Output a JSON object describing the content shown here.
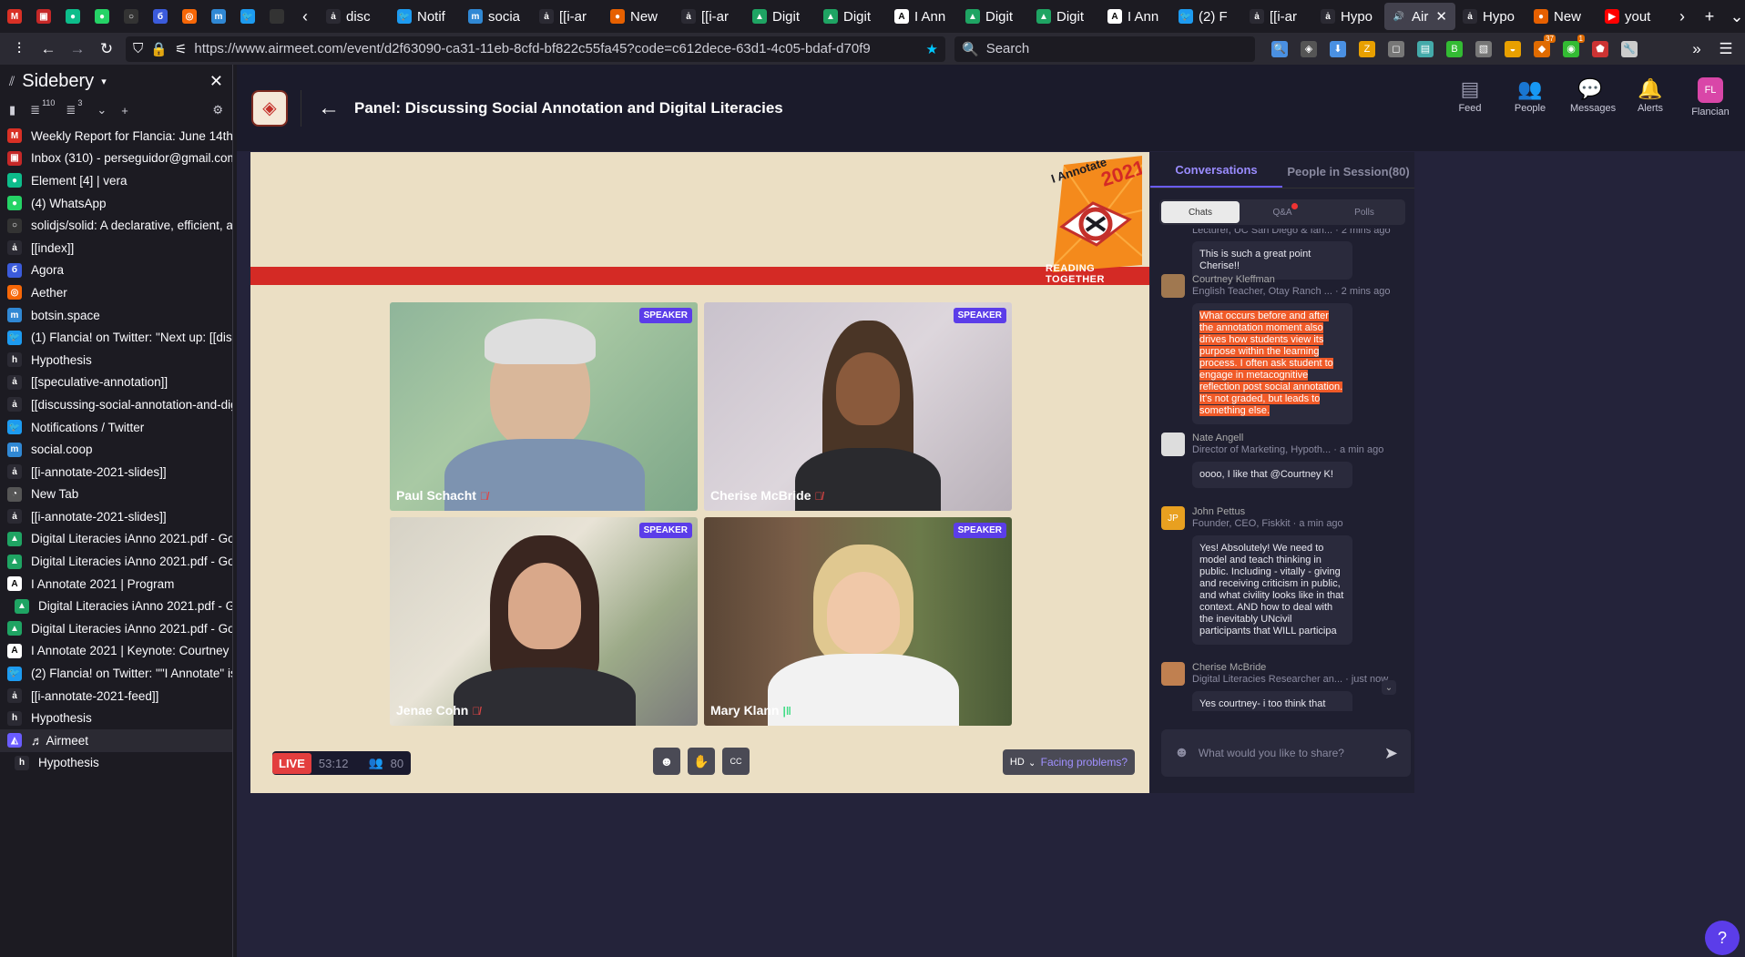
{
  "browser": {
    "pinned_tabs": [
      {
        "icon": "gmail-icon",
        "color": "#d93025",
        "glyph": "M"
      },
      {
        "icon": "inbox-icon",
        "color": "#c62828",
        "glyph": "▣"
      },
      {
        "icon": "element-icon",
        "color": "#0dbd8b",
        "glyph": "●"
      },
      {
        "icon": "whatsapp-icon",
        "color": "#25d366",
        "glyph": "●"
      },
      {
        "icon": "github-icon",
        "color": "#333",
        "glyph": "○"
      },
      {
        "icon": "agora-icon",
        "color": "#3b5bdb",
        "glyph": "б"
      },
      {
        "icon": "aether-icon",
        "color": "#f76707",
        "glyph": "◎"
      },
      {
        "icon": "mastodon-icon",
        "color": "#3088d4",
        "glyph": "m"
      },
      {
        "icon": "twitter-icon",
        "color": "#1d9bf0",
        "glyph": "🐦"
      },
      {
        "icon": "blank-icon",
        "color": "#333",
        "glyph": ""
      }
    ],
    "tabs": [
      {
        "label": "disc",
        "icon": "hypothesis-icon",
        "color": "#2b2a33",
        "glyph": "ȧ"
      },
      {
        "label": "Notif",
        "icon": "twitter-icon",
        "color": "#1d9bf0",
        "glyph": "🐦"
      },
      {
        "label": "socia",
        "icon": "mastodon-icon",
        "color": "#3088d4",
        "glyph": "m"
      },
      {
        "label": "[[i-ar",
        "icon": "hypothesis-icon",
        "color": "#2b2a33",
        "glyph": "ȧ"
      },
      {
        "label": "New",
        "icon": "firefox-icon",
        "color": "#e66000",
        "glyph": "●"
      },
      {
        "label": "[[i-ar",
        "icon": "hypothesis-icon",
        "color": "#2b2a33",
        "glyph": "ȧ"
      },
      {
        "label": "Digit",
        "icon": "drive-icon",
        "color": "#1fa463",
        "glyph": "▲"
      },
      {
        "label": "Digit",
        "icon": "drive-icon",
        "color": "#1fa463",
        "glyph": "▲"
      },
      {
        "label": "I Ann",
        "icon": "iannotate-icon",
        "color": "#ffffff",
        "glyph": "A"
      },
      {
        "label": "Digit",
        "icon": "drive-icon",
        "color": "#1fa463",
        "glyph": "▲"
      },
      {
        "label": "Digit",
        "icon": "drive-icon",
        "color": "#1fa463",
        "glyph": "▲"
      },
      {
        "label": "I Ann",
        "icon": "iannotate-icon",
        "color": "#ffffff",
        "glyph": "A"
      },
      {
        "label": "(2) F",
        "icon": "twitter-icon",
        "color": "#1d9bf0",
        "glyph": "🐦"
      },
      {
        "label": "[[i-ar",
        "icon": "hypothesis-icon",
        "color": "#2b2a33",
        "glyph": "ȧ"
      },
      {
        "label": "Hypo",
        "icon": "hypothesis-icon",
        "color": "#2b2a33",
        "glyph": "ȧ"
      },
      {
        "label": "Air",
        "icon": "speaker-icon",
        "color": "#42414d",
        "glyph": "🔊",
        "active": true
      },
      {
        "label": "Hypo",
        "icon": "hypothesis-icon",
        "color": "#2b2a33",
        "glyph": "ȧ"
      },
      {
        "label": "New",
        "icon": "firefox-icon",
        "color": "#e66000",
        "glyph": "●"
      },
      {
        "label": "yout",
        "icon": "youtube-icon",
        "color": "#ff0000",
        "glyph": "▶"
      }
    ],
    "url": "https://www.airmeet.com/event/d2f63090-ca31-11eb-8cfd-bf822c55fa45?code=c612dece-63d1-4c05-bdaf-d70f9",
    "search_placeholder": "Search",
    "extensions": [
      {
        "icon": "search-icon",
        "color": "#4a90e2",
        "glyph": "🔍"
      },
      {
        "icon": "pocket-icon",
        "color": "#555",
        "glyph": "◈"
      },
      {
        "icon": "download-icon",
        "color": "#4a90e2",
        "glyph": "⬇"
      },
      {
        "icon": "zotero-icon",
        "color": "#e8a000",
        "glyph": "Z"
      },
      {
        "icon": "box-icon",
        "color": "#777",
        "glyph": "◻"
      },
      {
        "icon": "rss-icon",
        "color": "#4aa",
        "glyph": "▤"
      },
      {
        "icon": "badge-icon",
        "color": "#3b3",
        "glyph": "B"
      },
      {
        "icon": "page-icon",
        "color": "#777",
        "glyph": "▧"
      },
      {
        "icon": "burger-icon",
        "color": "#e8a000",
        "glyph": "◒"
      },
      {
        "icon": "ext-badge-icon",
        "color": "#e06b00",
        "glyph": "◆",
        "badge": "37"
      },
      {
        "icon": "eye-icon",
        "color": "#3b3",
        "glyph": "◉",
        "badge": "1"
      },
      {
        "icon": "shield-icon",
        "color": "#c33",
        "glyph": "⬟"
      },
      {
        "icon": "wrench-icon",
        "color": "#ccc",
        "glyph": "🔧"
      }
    ]
  },
  "sidebar": {
    "title": "Sidebery",
    "count_a": "110",
    "count_b": "3",
    "items": [
      {
        "label": "Weekly Report for Flancia: June 14th, 2021",
        "icon": "gmail-icon",
        "color": "#d93025",
        "glyph": "M"
      },
      {
        "label": "Inbox (310) - perseguidor@gmail.com - Gm",
        "icon": "inbox-icon",
        "color": "#c62828",
        "glyph": "▣"
      },
      {
        "label": "Element [4] | vera",
        "icon": "element-icon",
        "color": "#0dbd8b",
        "glyph": "●"
      },
      {
        "label": "(4) WhatsApp",
        "icon": "whatsapp-icon",
        "color": "#25d366",
        "glyph": "●"
      },
      {
        "label": "solidjs/solid: A declarative, efficient, and fle",
        "icon": "github-icon",
        "color": "#333",
        "glyph": "○"
      },
      {
        "label": "[[index]]",
        "icon": "hypothesis-icon",
        "color": "#2b2a33",
        "glyph": "ȧ"
      },
      {
        "label": "Agora",
        "icon": "agora-icon",
        "color": "#3b5bdb",
        "glyph": "б"
      },
      {
        "label": "Aether",
        "icon": "aether-icon",
        "color": "#f76707",
        "glyph": "◎"
      },
      {
        "label": "botsin.space",
        "icon": "mastodon-icon",
        "color": "#3088d4",
        "glyph": "m"
      },
      {
        "label": "(1) Flancia! on Twitter: \"Next up: [[discussin",
        "icon": "twitter-icon",
        "color": "#1d9bf0",
        "glyph": "🐦"
      },
      {
        "label": "Hypothesis",
        "icon": "hypothesis-icon",
        "color": "#2b2a33",
        "glyph": "h"
      },
      {
        "label": "[[speculative-annotation]]",
        "icon": "hypothesis-icon",
        "color": "#2b2a33",
        "glyph": "ȧ"
      },
      {
        "label": "[[discussing-social-annotation-and-digital-li",
        "icon": "hypothesis-icon",
        "color": "#2b2a33",
        "glyph": "ȧ"
      },
      {
        "label": "Notifications / Twitter",
        "icon": "twitter-icon",
        "color": "#1d9bf0",
        "glyph": "🐦"
      },
      {
        "label": "social.coop",
        "icon": "mastodon-icon",
        "color": "#3088d4",
        "glyph": "m"
      },
      {
        "label": "[[i-annotate-2021-slides]]",
        "icon": "hypothesis-icon",
        "color": "#2b2a33",
        "glyph": "ȧ"
      },
      {
        "label": "New Tab",
        "icon": "firefox-icon",
        "color": "#555",
        "glyph": "◔"
      },
      {
        "label": "[[i-annotate-2021-slides]]",
        "icon": "hypothesis-icon",
        "color": "#2b2a33",
        "glyph": "ȧ"
      },
      {
        "label": "Digital Literacies iAnno 2021.pdf - Google D",
        "icon": "drive-icon",
        "color": "#1fa463",
        "glyph": "▲"
      },
      {
        "label": "Digital Literacies iAnno 2021.pdf - Google D",
        "icon": "drive-icon",
        "color": "#1fa463",
        "glyph": "▲"
      },
      {
        "label": "I Annotate 2021 | Program",
        "icon": "iannotate-icon",
        "color": "#ffffff",
        "glyph": "A"
      },
      {
        "label": "Digital Literacies iAnno 2021.pdf - Google",
        "icon": "drive-icon",
        "color": "#1fa463",
        "glyph": "▲",
        "child": true
      },
      {
        "label": "Digital Literacies iAnno 2021.pdf - Google D",
        "icon": "drive-icon",
        "color": "#1fa463",
        "glyph": "▲"
      },
      {
        "label": "I Annotate 2021 | Keynote: Courtney McCle",
        "icon": "iannotate-icon",
        "color": "#ffffff",
        "glyph": "A"
      },
      {
        "label": "(2) Flancia! on Twitter: \"\"I Annotate\" is goin",
        "icon": "twitter-icon",
        "color": "#1d9bf0",
        "glyph": "🐦"
      },
      {
        "label": "[[i-annotate-2021-feed]]",
        "icon": "hypothesis-icon",
        "color": "#2b2a33",
        "glyph": "ȧ"
      },
      {
        "label": "Hypothesis",
        "icon": "hypothesis-icon",
        "color": "#2b2a33",
        "glyph": "h"
      },
      {
        "label": "♬ Airmeet",
        "icon": "airmeet-icon",
        "color": "#6a5cff",
        "glyph": "◭",
        "active": true
      },
      {
        "label": "Hypothesis",
        "icon": "hypothesis-icon",
        "color": "#2b2a33",
        "glyph": "h",
        "child": true
      }
    ]
  },
  "airmeet": {
    "title": "Panel: Discussing Social Annotation and Digital Literacies",
    "nav": [
      {
        "label": "Feed",
        "icon": "feed-icon",
        "glyph": "▤"
      },
      {
        "label": "People",
        "icon": "people-icon",
        "glyph": "👥"
      },
      {
        "label": "Messages",
        "icon": "messages-icon",
        "glyph": "💬"
      },
      {
        "label": "Alerts",
        "icon": "bell-icon",
        "glyph": "🔔"
      },
      {
        "label": "Flancian",
        "icon": "avatar",
        "glyph": "FL"
      }
    ],
    "badge_title": "I Annotate",
    "badge_year": "2021",
    "badge_sub": "READING TOGETHER",
    "speaker_tag": "SPEAKER",
    "speakers": [
      {
        "name": "Paul Schacht",
        "mic": "muted"
      },
      {
        "name": "Cherise McBride",
        "mic": "muted"
      },
      {
        "name": "Jenae Cohn",
        "mic": "muted"
      },
      {
        "name": "Mary Klann",
        "mic": "active"
      }
    ],
    "live_label": "LIVE",
    "timer": "53:12",
    "attendees": "80",
    "hd_label": "HD",
    "facing_label": "Facing problems?",
    "panel": {
      "tab_conversations": "Conversations",
      "tab_people": "People in Session(80)",
      "subtabs": [
        "Chats",
        "Q&A",
        "Polls"
      ],
      "partial_role": "Lecturer, UC San Diego & Ian... · 2 mins ago",
      "messages": [
        {
          "name": "",
          "role": "",
          "text": "This is such a great point Cherise!!",
          "avatar": "",
          "color": "#2a2a3c"
        },
        {
          "name": "Courtney Kleffman",
          "role": "English Teacher, Otay Ranch ... · 2 mins ago",
          "text": "What occurs before and after the annotation moment also drives how students view its purpose within the learning process. I often ask student to engage in metacognitive reflection post social annotation. It's not graded, but leads to something else.",
          "avatar": "",
          "color": "#a07850",
          "highlight": true
        },
        {
          "name": "Nate Angell",
          "role": "Director of Marketing, Hypoth... · a min ago",
          "text": "oooo, I like that @Courtney K!",
          "avatar": "",
          "color": "#dddddd"
        },
        {
          "name": "John Pettus",
          "role": "Founder, CEO, Fiskkit · a min ago",
          "text": "Yes! Absolutely! We need to model and teach thinking in public. Including - vitally - giving and receiving criticism in public, and what civility looks like in that context. AND how to deal with the inevitably UNcivil participants that WILL participa",
          "avatar": "JP",
          "color": "#e8a020"
        },
        {
          "name": "Cherise McBride",
          "role": "Digital Literacies Researcher an... · just now",
          "text": "Yes courtney- i too think that reflective space is integral to student experience ...and that it offers additional formative assessment",
          "avatar": "",
          "color": "#c08050"
        }
      ],
      "input_placeholder": "What would you like to share?"
    }
  }
}
